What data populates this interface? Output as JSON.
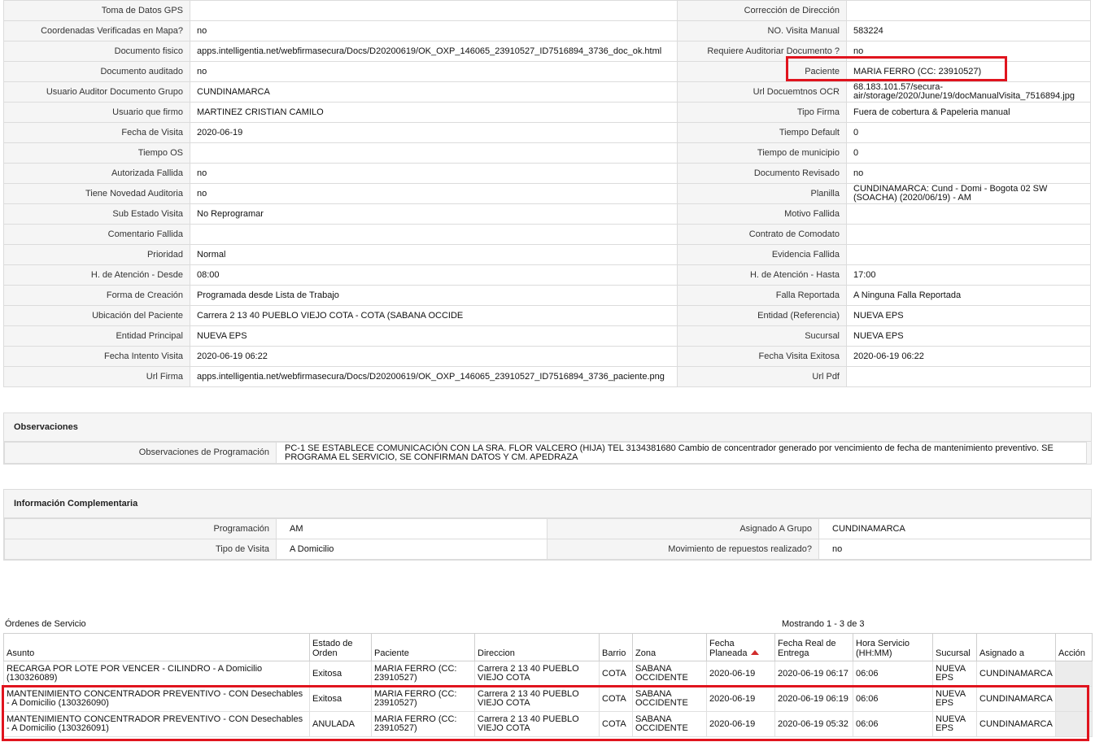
{
  "detail_rows": [
    {
      "l1": "Toma de Datos GPS",
      "v1": "",
      "l2": "Corrección de Dirección",
      "v2": ""
    },
    {
      "l1": "Coordenadas Verificadas en Mapa?",
      "v1": "no",
      "l2": "NO. Visita Manual",
      "v2": " 583224"
    },
    {
      "l1": "Documento fisico",
      "v1": "apps.intelligentia.net/webfirmasecura/Docs/D20200619/OK_OXP_146065_23910527_ID7516894_3736_doc_ok.html",
      "l2": "Requiere Auditoriar Documento ?",
      "v2": "no"
    },
    {
      "l1": "Documento auditado",
      "v1": "no",
      "l2": "Paciente",
      "v2": "MARIA FERRO (CC: 23910527)"
    },
    {
      "l1": "Usuario Auditor Documento Grupo",
      "v1": " CUNDINAMARCA",
      "l2": "Url Docuemtnos OCR",
      "v2": "68.183.101.57/secura-air/storage/2020/June/19/docManualVisita_7516894.jpg"
    },
    {
      "l1": "Usuario que firmo",
      "v1": "MARTINEZ CRISTIAN CAMILO",
      "l2": "Tipo Firma",
      "v2": " Fuera de cobertura & Papeleria manual"
    },
    {
      "l1": "Fecha de Visita",
      "v1": "2020-06-19",
      "l2": "Tiempo Default",
      "v2": " 0"
    },
    {
      "l1": "Tiempo OS",
      "v1": "",
      "l2": "Tiempo de municipio",
      "v2": " 0"
    },
    {
      "l1": "Autorizada Fallida",
      "v1": "no",
      "l2": "Documento Revisado",
      "v2": "no"
    },
    {
      "l1": "Tiene Novedad Auditoria",
      "v1": "no",
      "l2": "Planilla",
      "v2": "CUNDINAMARCA: Cund - Domi - Bogota 02 SW (SOACHA) (2020/06/19) - AM"
    },
    {
      "l1": "Sub Estado Visita",
      "v1": " No Reprogramar",
      "l2": "Motivo Fallida",
      "v2": ""
    },
    {
      "l1": "Comentario Fallida",
      "v1": "",
      "l2": "Contrato de Comodato",
      "v2": ""
    },
    {
      "l1": "Prioridad",
      "v1": " Normal",
      "l2": "Evidencia Fallida",
      "v2": ""
    },
    {
      "l1": "H. de Atención - Desde",
      "v1": " 08:00",
      "l2": "H. de Atención - Hasta",
      "v2": " 17:00"
    },
    {
      "l1": "Forma de Creación",
      "v1": " Programada desde Lista de Trabajo",
      "l2": "Falla Reportada",
      "v2": " A Ninguna Falla Reportada"
    },
    {
      "l1": "Ubicación del Paciente",
      "v1": "Carrera 2 13 40 PUEBLO VIEJO COTA - COTA (SABANA OCCIDE",
      "l2": "Entidad (Referencia)",
      "v2": "NUEVA EPS"
    },
    {
      "l1": "Entidad Principal",
      "v1": " NUEVA EPS",
      "l2": "Sucursal",
      "v2": " NUEVA EPS"
    },
    {
      "l1": "Fecha Intento Visita",
      "v1": "2020-06-19 06:22",
      "l2": "Fecha Visita Exitosa",
      "v2": "2020-06-19 06:22"
    },
    {
      "l1": "Url Firma",
      "v1": "apps.intelligentia.net/webfirmasecura/Docs/D20200619/OK_OXP_146065_23910527_ID7516894_3736_paciente.png",
      "l2": "Url Pdf",
      "v2": ""
    }
  ],
  "observaciones": {
    "title": "Observaciones",
    "label": "Observaciones de Programación",
    "value": "PC-1 SE ESTABLECE COMUNICACIÓN CON LA SRA. FLOR VALCERO (HIJA) TEL 3134381680 Cambio de concentrador generado por vencimiento de fecha de mantenimiento preventivo. SE PROGRAMA EL SERVICIO, SE CONFIRMAN DATOS Y CM. APEDRAZA"
  },
  "info": {
    "title": "Información Complementaria",
    "rows": [
      {
        "l1": "Programación",
        "v1": "AM",
        "l2": "Asignado A Grupo",
        "v2": "CUNDINAMARCA"
      },
      {
        "l1": "Tipo de Visita",
        "v1": "A Domicilio",
        "l2": "Movimiento de repuestos realizado?",
        "v2": "no"
      }
    ]
  },
  "orders": {
    "title": "Órdenes de Servicio",
    "count": "Mostrando 1 - 3 de 3",
    "columns": [
      "Asunto",
      "Estado de Orden",
      "Paciente",
      "Direccion",
      "Barrio",
      "Zona",
      "Fecha Planeada",
      "Fecha Real de Entrega",
      "Hora Servicio (HH:MM)",
      "Sucursal",
      "Asignado a",
      "Acción"
    ],
    "rows": [
      [
        "RECARGA POR LOTE POR VENCER - CILINDRO - A Domicilio (130326089)",
        "Exitosa",
        "MARIA FERRO (CC: 23910527)",
        "Carrera 2 13 40 PUEBLO VIEJO COTA",
        "COTA",
        "SABANA OCCIDENTE",
        "2020-06-19",
        "2020-06-19 06:17",
        "06:06",
        "NUEVA EPS",
        "CUNDINAMARCA",
        ""
      ],
      [
        "MANTENIMIENTO CONCENTRADOR PREVENTIVO - CON Desechables - A Domicilio (130326090)",
        "Exitosa",
        "MARIA FERRO (CC: 23910527)",
        "Carrera 2 13 40 PUEBLO VIEJO COTA",
        "COTA",
        "SABANA OCCIDENTE",
        "2020-06-19",
        "2020-06-19 06:19",
        "06:06",
        "NUEVA EPS",
        "CUNDINAMARCA",
        ""
      ],
      [
        "MANTENIMIENTO CONCENTRADOR PREVENTIVO - CON Desechables - A Domicilio (130326091)",
        "ANULADA",
        "MARIA FERRO (CC: 23910527)",
        "Carrera 2 13 40 PUEBLO VIEJO COTA",
        "COTA",
        "SABANA OCCIDENTE",
        "2020-06-19",
        "2020-06-19 05:32",
        "06:06",
        "NUEVA EPS",
        "CUNDINAMARCA",
        ""
      ]
    ]
  },
  "colors": {
    "highlight": "#e0141e",
    "label_bg": "#f5f5f5",
    "border": "#dcdcdc",
    "sort_arrow": "#d12c2c"
  }
}
